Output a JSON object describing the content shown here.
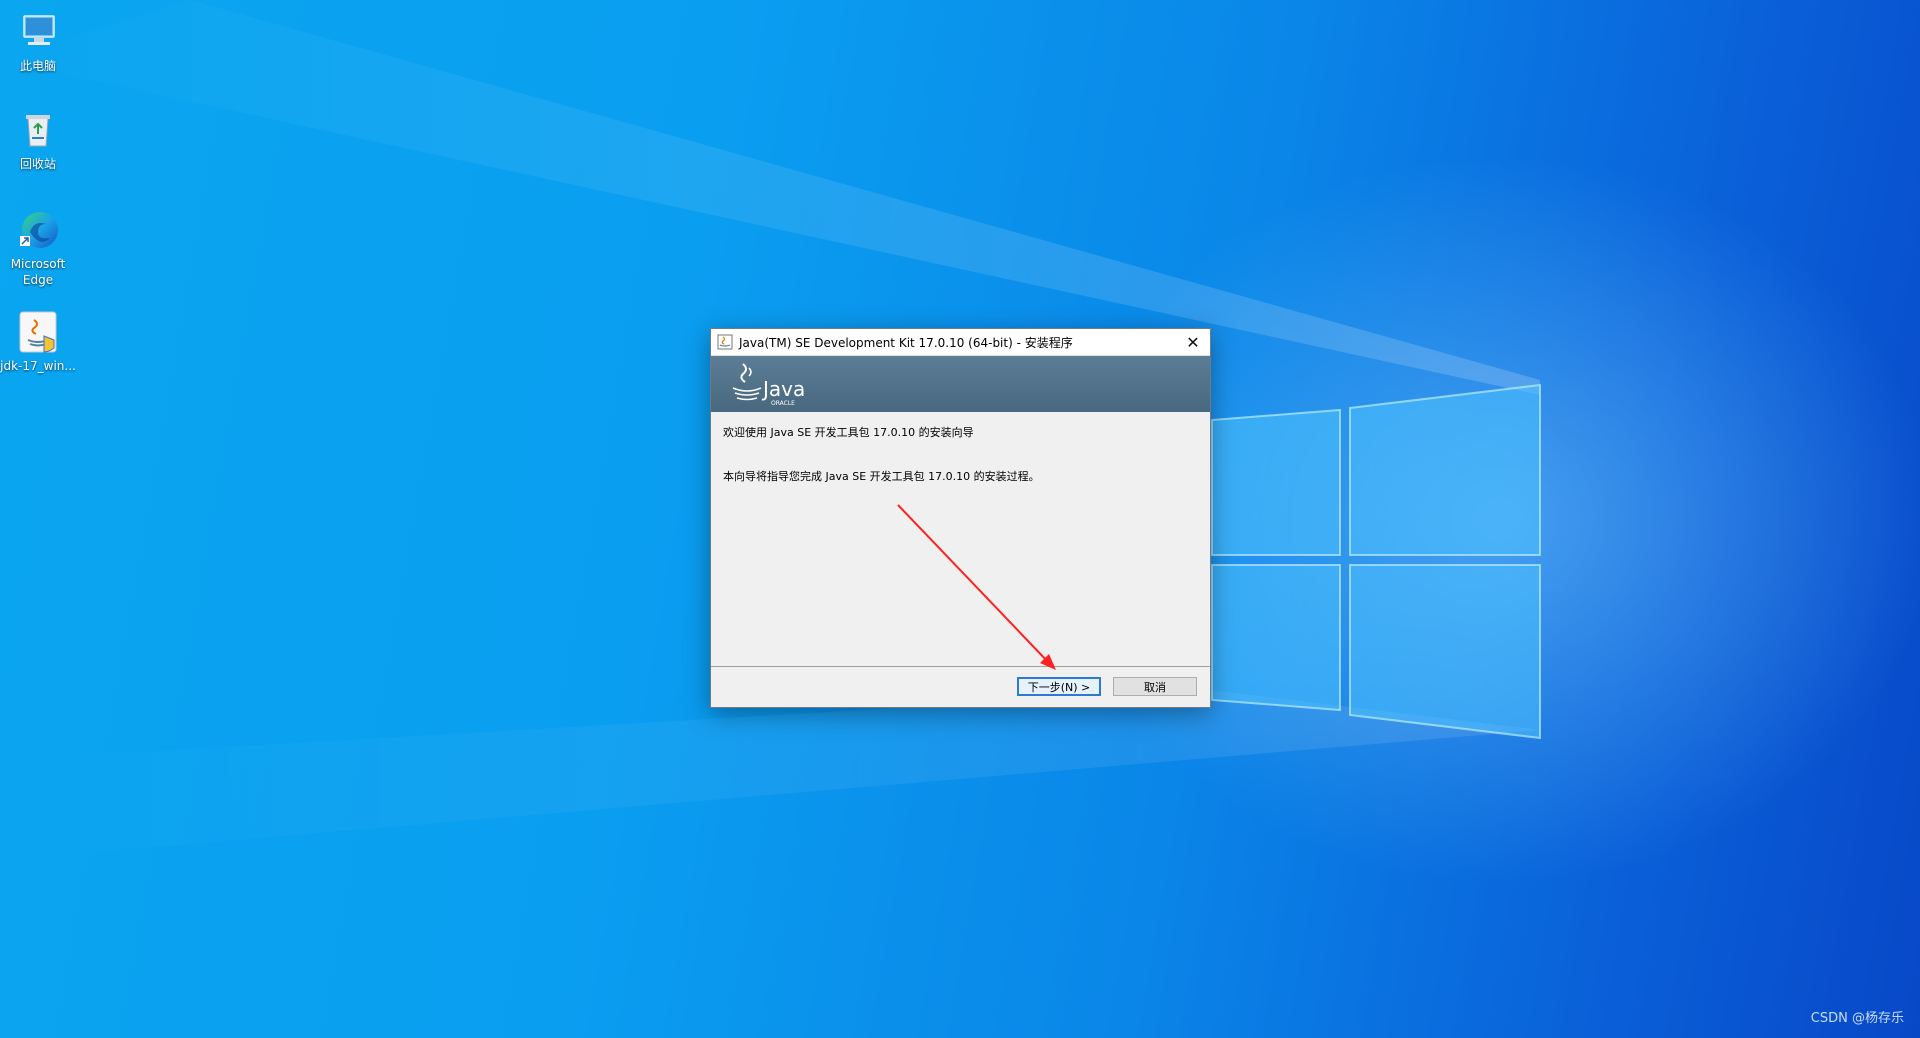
{
  "desktop": {
    "icons": [
      {
        "label": "此电脑",
        "icon": "computer-icon"
      },
      {
        "label": "回收站",
        "icon": "recycle-bin-icon"
      },
      {
        "label": "Microsoft Edge",
        "icon": "edge-icon"
      },
      {
        "label": "jdk-17_win...",
        "icon": "java-installer-icon"
      }
    ]
  },
  "window": {
    "title": "Java(TM) SE Development Kit 17.0.10 (64-bit) - 安装程序",
    "close_glyph": "✕",
    "logo_text": "Java",
    "logo_subtext": "ORACLE",
    "welcome_text": "欢迎使用 Java SE 开发工具包 17.0.10 的安装向导",
    "description_text": "本向导将指导您完成 Java SE 开发工具包 17.0.10 的安装过程。",
    "next_button": "下一步(N) >",
    "cancel_button": "取消"
  },
  "watermark": "CSDN @杨存乐",
  "colors": {
    "banner": "#4f7088",
    "focus_border": "#2e7ad1",
    "annotation_arrow": "#ff2020"
  }
}
